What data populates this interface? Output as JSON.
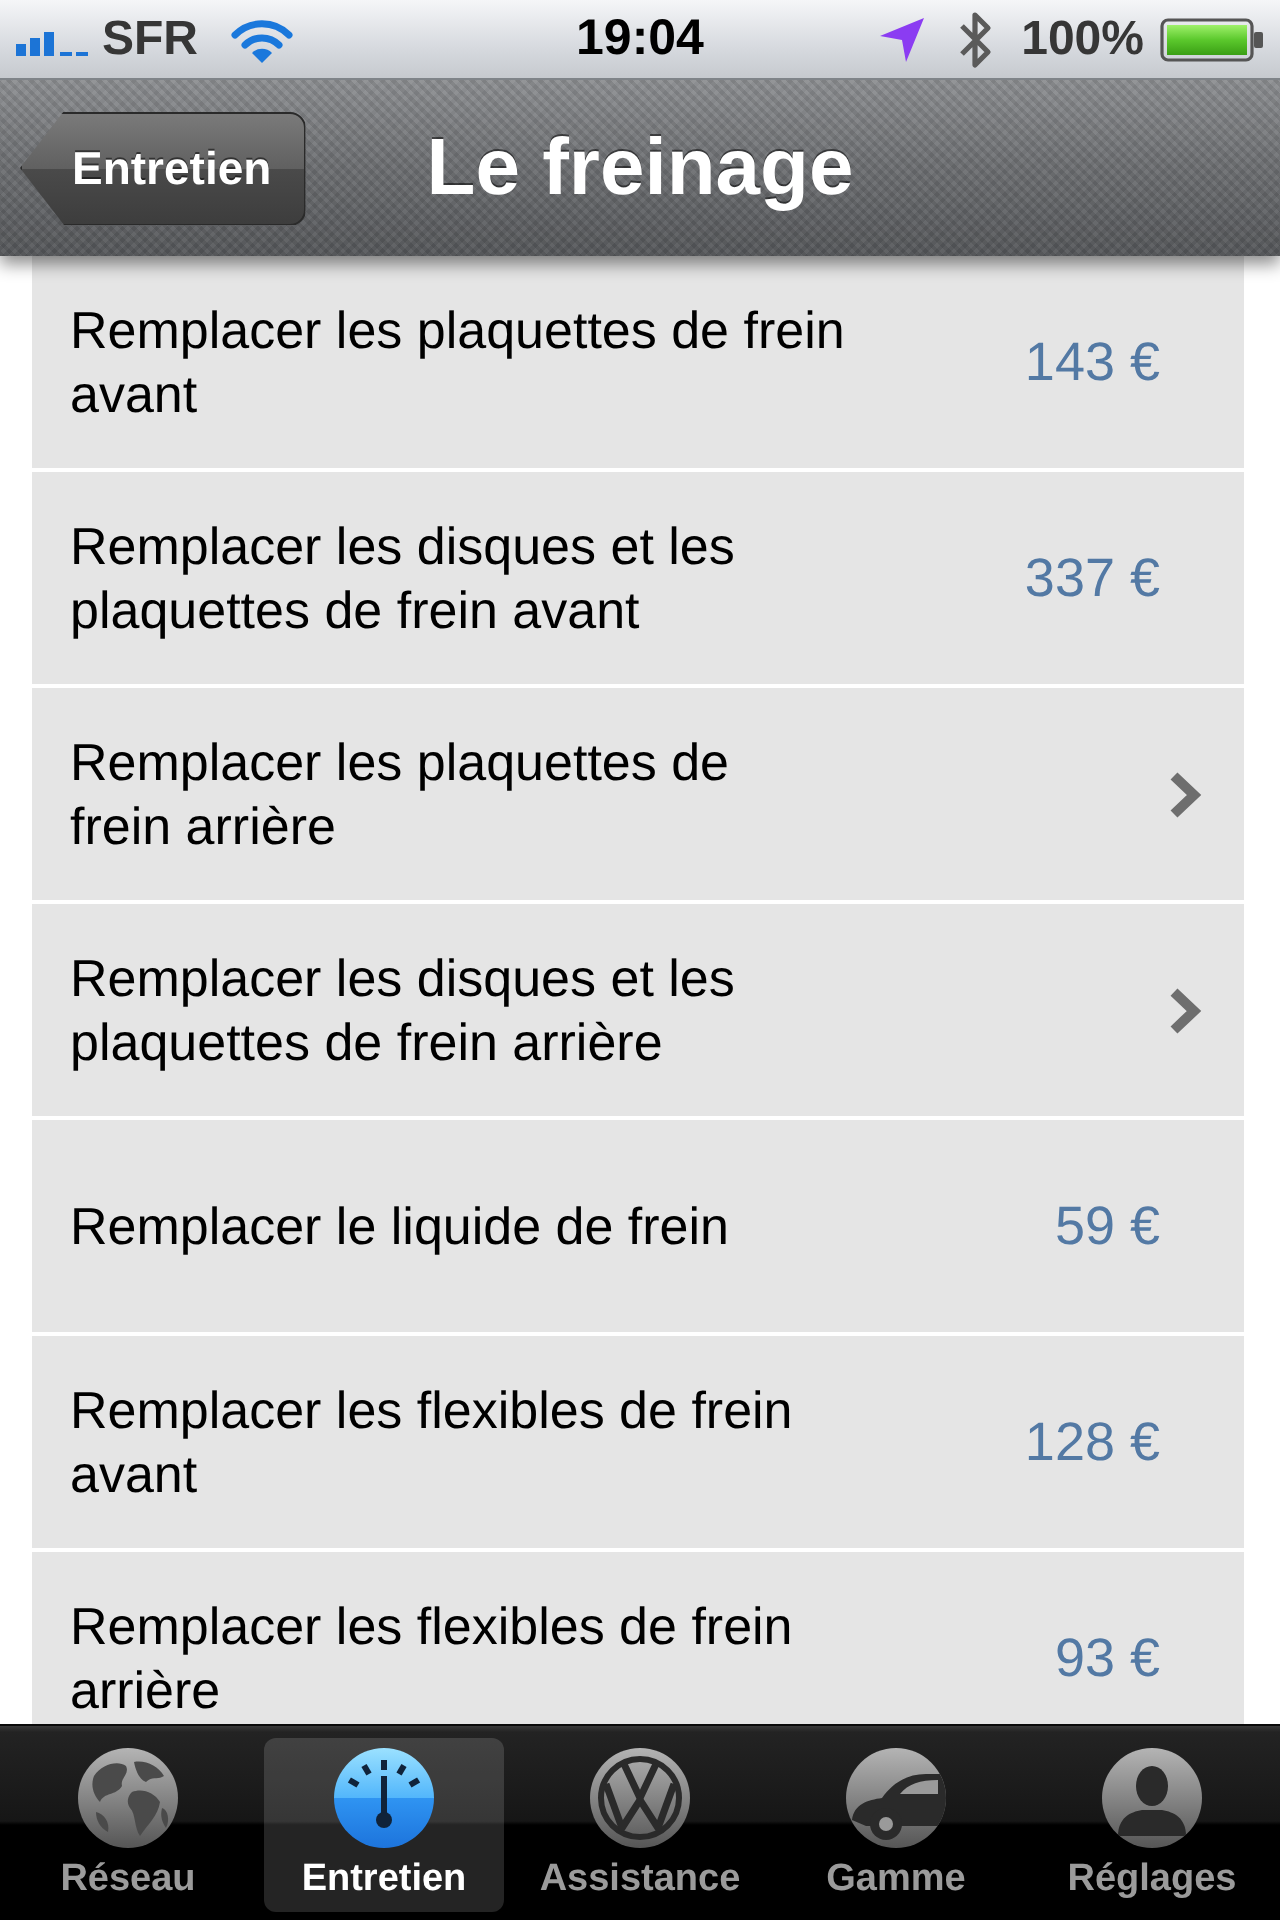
{
  "status_bar": {
    "carrier": "SFR",
    "time": "19:04",
    "battery": "100%"
  },
  "nav_bar": {
    "back_button": "Entretien",
    "title": "Le freinage"
  },
  "rows": [
    {
      "kind": "price",
      "label": "Remplacer les plaquettes de frein avant",
      "price": "143 €"
    },
    {
      "kind": "price",
      "label": "Remplacer les disques et les plaquettes de frein avant",
      "price": "337 €"
    },
    {
      "kind": "disclosure",
      "label": "Remplacer les plaquettes de frein arrière"
    },
    {
      "kind": "disclosure",
      "label": "Remplacer les disques et les plaquettes de frein arrière"
    },
    {
      "kind": "price",
      "label": "Remplacer le liquide de frein",
      "price": "59 €"
    },
    {
      "kind": "price",
      "label": "Remplacer les flexibles de frein avant",
      "price": "128 €"
    },
    {
      "kind": "price",
      "label": "Remplacer les flexibles de frein arrière",
      "price": "93 €"
    }
  ],
  "tab_bar": {
    "tabs": [
      {
        "label": "Réseau",
        "kind": "globe",
        "selected": false
      },
      {
        "label": "Entretien",
        "kind": "gauge",
        "selected": true
      },
      {
        "label": "Assistance",
        "kind": "emblem",
        "selected": false
      },
      {
        "label": "Gamme",
        "kind": "car",
        "selected": false
      },
      {
        "label": "Réglages",
        "kind": "person",
        "selected": false
      }
    ]
  }
}
